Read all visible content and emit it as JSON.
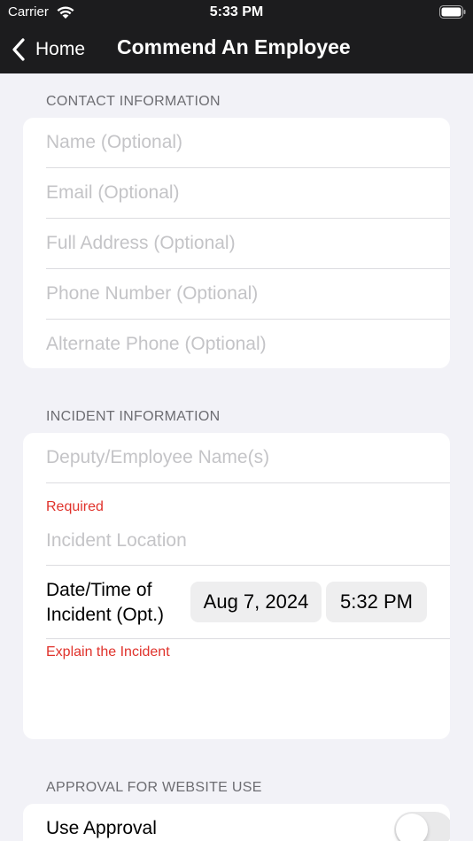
{
  "status_bar": {
    "carrier": "Carrier",
    "time": "5:33 PM",
    "wifi_icon": "wifi-icon",
    "battery_icon": "battery-icon"
  },
  "navbar": {
    "back_label": "Home",
    "back_icon": "chevron-left-icon",
    "title": "Commend An Employee",
    "background": "#1c1c1e"
  },
  "contact": {
    "header": "CONTACT INFORMATION",
    "fields": [
      {
        "placeholder": "Name (Optional)",
        "value": ""
      },
      {
        "placeholder": "Email (Optional)",
        "value": ""
      },
      {
        "placeholder": "Full Address (Optional)",
        "value": ""
      },
      {
        "placeholder": "Phone Number (Optional)",
        "value": ""
      },
      {
        "placeholder": "Alternate Phone (Optional)",
        "value": ""
      }
    ]
  },
  "incident": {
    "header": "INCIDENT INFORMATION",
    "employee_placeholder": "Deputy/Employee Name(s)",
    "required_text": "Required",
    "location_placeholder": "Incident Location",
    "datetime_label_line1": "Date/Time of",
    "datetime_label_line2": "Incident (Opt.)",
    "date_value": "Aug 7, 2024",
    "time_value": "5:32 PM",
    "explain_text": "Explain the Incident",
    "explain_value": ""
  },
  "approval": {
    "header": "APPROVAL FOR WEBSITE USE",
    "label": "Use Approval",
    "toggle_on": false
  },
  "colors": {
    "background": "#f2f2f7",
    "error": "#e0322b",
    "placeholder": "#c4c4c7",
    "header_text": "#6d6d72"
  }
}
